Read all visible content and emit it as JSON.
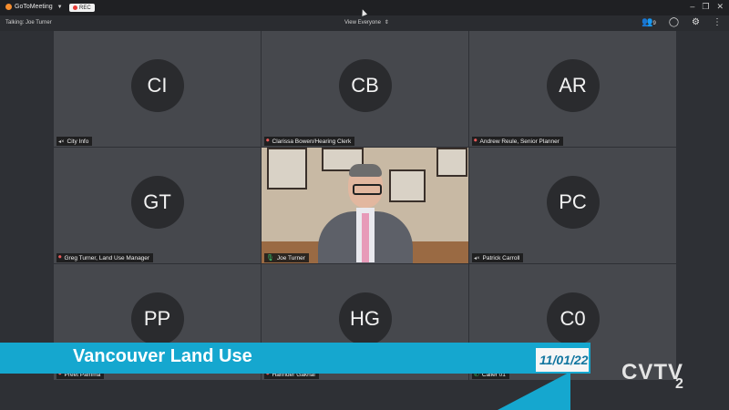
{
  "app": {
    "name": "GoToMeeting",
    "rec_label": "REC",
    "talking_label": "Talking: Joe Turner",
    "view_label": "View Everyone",
    "participants_count": "9"
  },
  "tiles": [
    {
      "initials": "CI",
      "name": "City  Info",
      "status": "speaker"
    },
    {
      "initials": "CB",
      "name": "Clarissa Bowen/Hearing Clerk",
      "status": "muted"
    },
    {
      "initials": "AR",
      "name": "Andrew Reule, Senior Planner",
      "status": "muted"
    },
    {
      "initials": "GT",
      "name": "Greg Turner, Land Use Manager",
      "status": "muted"
    },
    {
      "initials": "",
      "name": "Joe Turner",
      "status": "mic"
    },
    {
      "initials": "PC",
      "name": "Patrick Carroll",
      "status": "speaker"
    },
    {
      "initials": "PP",
      "name": "Preet Pamma",
      "status": "muted"
    },
    {
      "initials": "HG",
      "name": "Harinder Gakhal",
      "status": "muted"
    },
    {
      "initials": "C0",
      "name": "Caller 01",
      "status": "phone"
    }
  ],
  "overlay": {
    "title": "Vancouver Land Use",
    "date": "11/01/22",
    "brand": "CVTV",
    "brand_sub": "2",
    "accent_color": "#15a7cf"
  }
}
